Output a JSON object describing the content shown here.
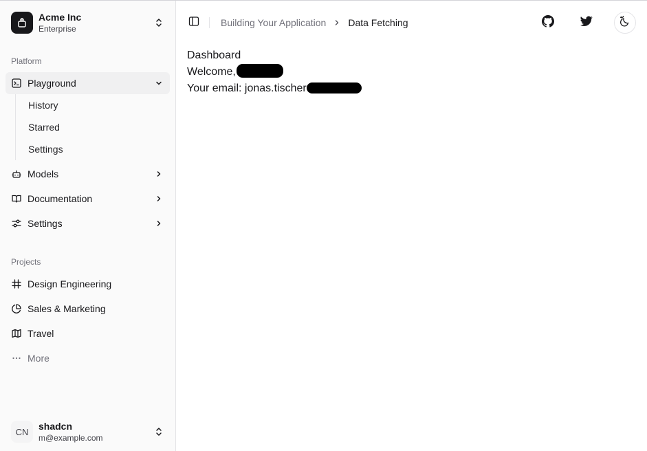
{
  "team": {
    "name": "Acme Inc",
    "plan": "Enterprise",
    "icon": "command-icon"
  },
  "sidebar": {
    "platform_label": "Platform",
    "platform_items": [
      {
        "label": "Playground",
        "icon": "terminal-icon",
        "expanded": true,
        "children": [
          "History",
          "Starred",
          "Settings"
        ]
      },
      {
        "label": "Models",
        "icon": "bot-icon"
      },
      {
        "label": "Documentation",
        "icon": "book-open-icon"
      },
      {
        "label": "Settings",
        "icon": "settings-sliders-icon"
      }
    ],
    "projects_label": "Projects",
    "projects": [
      {
        "label": "Design Engineering",
        "icon": "frame-icon"
      },
      {
        "label": "Sales & Marketing",
        "icon": "pie-chart-icon"
      },
      {
        "label": "Travel",
        "icon": "map-icon"
      }
    ],
    "more_label": "More"
  },
  "user": {
    "initials": "CN",
    "name": "shadcn",
    "email": "m@example.com"
  },
  "header": {
    "breadcrumb_parent": "Building Your Application",
    "breadcrumb_current": "Data Fetching",
    "actions": [
      "github-icon",
      "twitter-icon",
      "theme-toggle-icon"
    ]
  },
  "content": {
    "title": "Dashboard",
    "welcome_prefix": "Welcome,",
    "email_prefix": "Your email: jonas.tischer"
  }
}
